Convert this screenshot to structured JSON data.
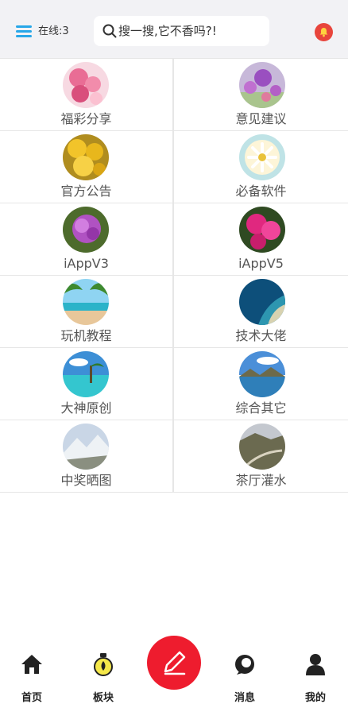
{
  "header": {
    "online_label": "在线:3",
    "search_placeholder": "搜一搜,它不香吗?!",
    "accent_color": "#28a7e8",
    "bell_color": "#e8453c"
  },
  "boards": [
    {
      "label": "福彩分享",
      "image": "pink-flowers"
    },
    {
      "label": "意见建议",
      "image": "purple-allium"
    },
    {
      "label": "官方公告",
      "image": "yellow-flowers"
    },
    {
      "label": "必备软件",
      "image": "white-daisy"
    },
    {
      "label": "iAppV3",
      "image": "purple-carnation"
    },
    {
      "label": "iAppV5",
      "image": "magenta-azalea"
    },
    {
      "label": "玩机教程",
      "image": "palm-beach"
    },
    {
      "label": "技术大佬",
      "image": "ocean-coast"
    },
    {
      "label": "大神原创",
      "image": "tropical-island"
    },
    {
      "label": "综合其它",
      "image": "mountain-lake"
    },
    {
      "label": "中奖晒图",
      "image": "snow-mountain"
    },
    {
      "label": "茶厅灌水",
      "image": "valley-road"
    }
  ],
  "tabbar": {
    "home": "首页",
    "boards": "板块",
    "messages": "消息",
    "mine": "我的",
    "fab_color": "#ee1c2e"
  }
}
